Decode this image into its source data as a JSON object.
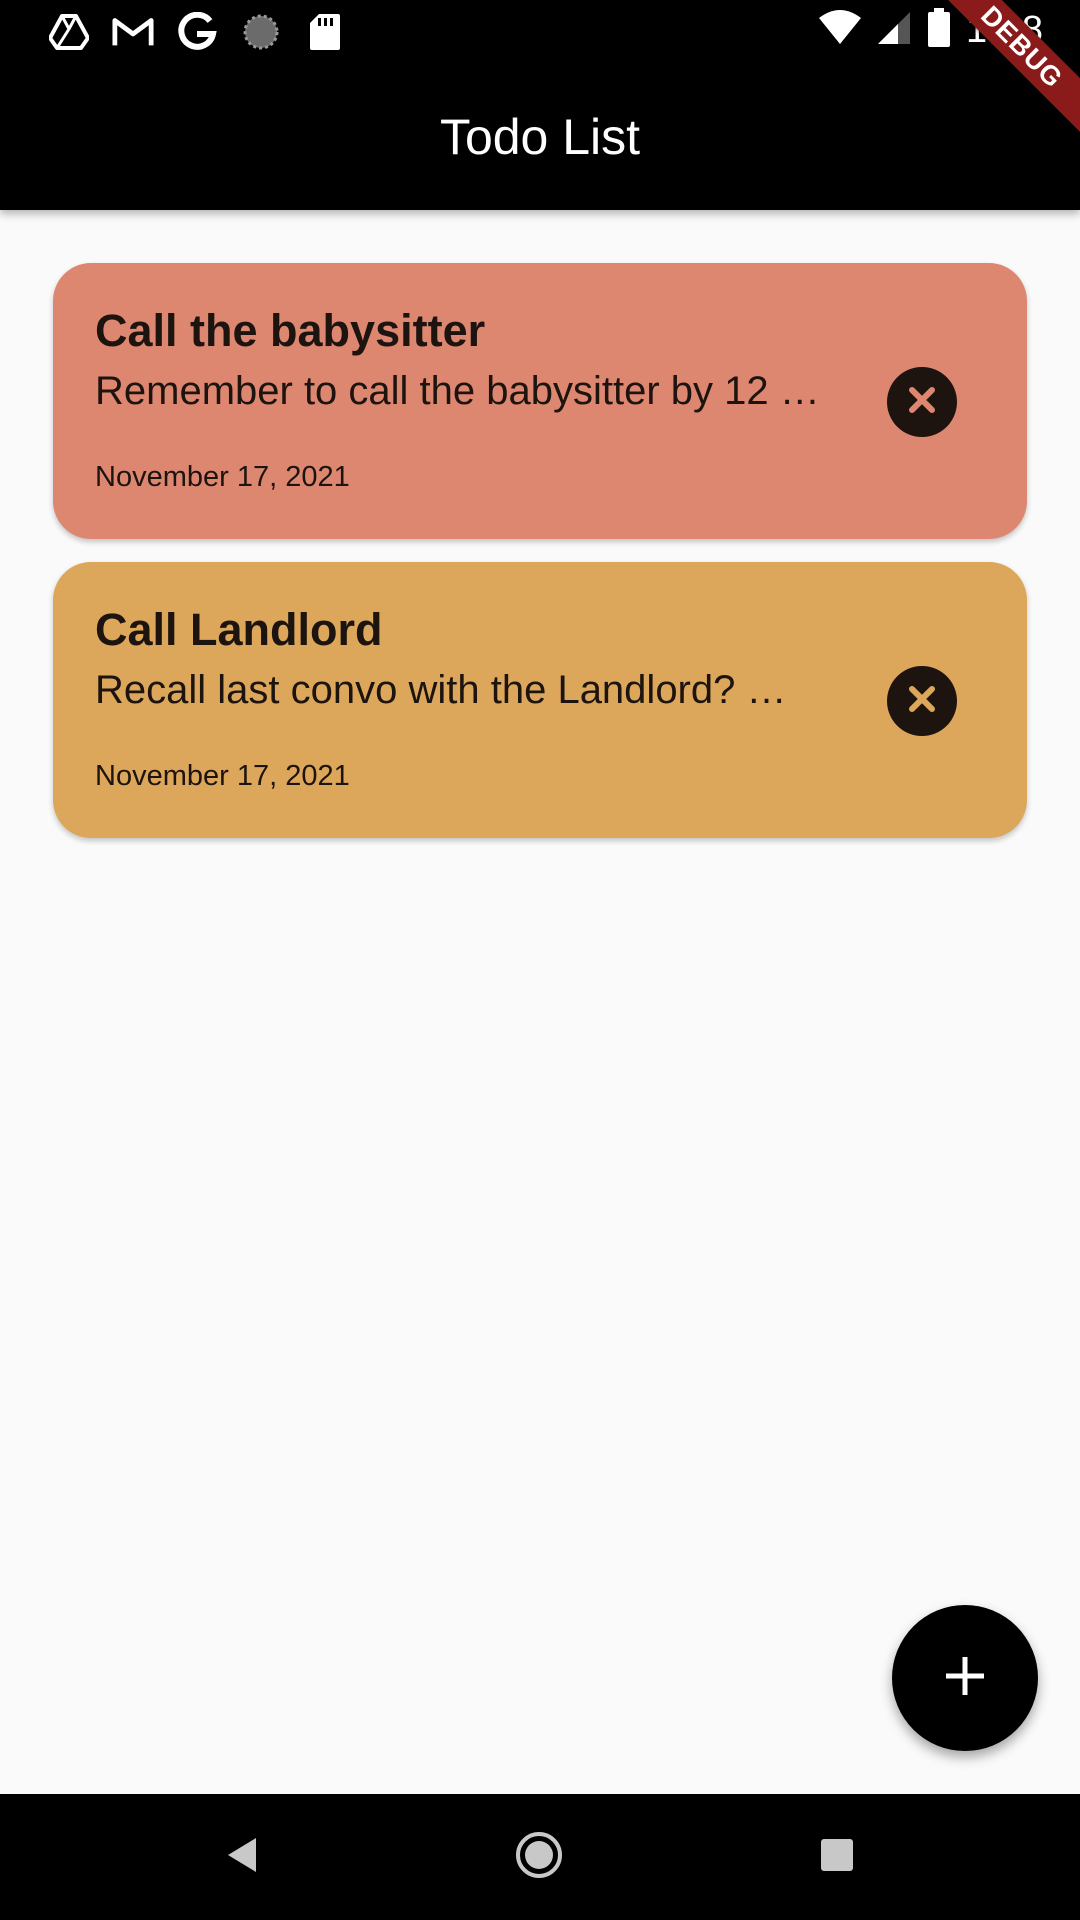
{
  "status_bar": {
    "time": "1:28",
    "left_icons": [
      "drive-icon",
      "gmail-icon",
      "google-icon",
      "sync-icon",
      "sd-card-icon"
    ],
    "right_icons": [
      "wifi-icon",
      "cell-signal-icon",
      "battery-icon"
    ]
  },
  "debug_banner": "DEBUG",
  "app_bar": {
    "title": "Todo List"
  },
  "todos": [
    {
      "title": "Call the babysitter",
      "description": "Remember to call the babysitter by 12 …",
      "date": "November 17, 2021",
      "color": "#dd8771"
    },
    {
      "title": "Call Landlord",
      "description": "Recall last convo with the Landlord? …",
      "date": "November 17, 2021",
      "color": "#dca75a"
    }
  ],
  "fab": {
    "icon": "add-icon"
  },
  "nav_bar": {
    "icons": [
      "back-icon",
      "home-icon",
      "recents-icon"
    ]
  },
  "colors": {
    "app_bar": "#000000",
    "background": "#fafafa",
    "text_dark": "#1d1410",
    "debug": "#8b1a1a"
  }
}
